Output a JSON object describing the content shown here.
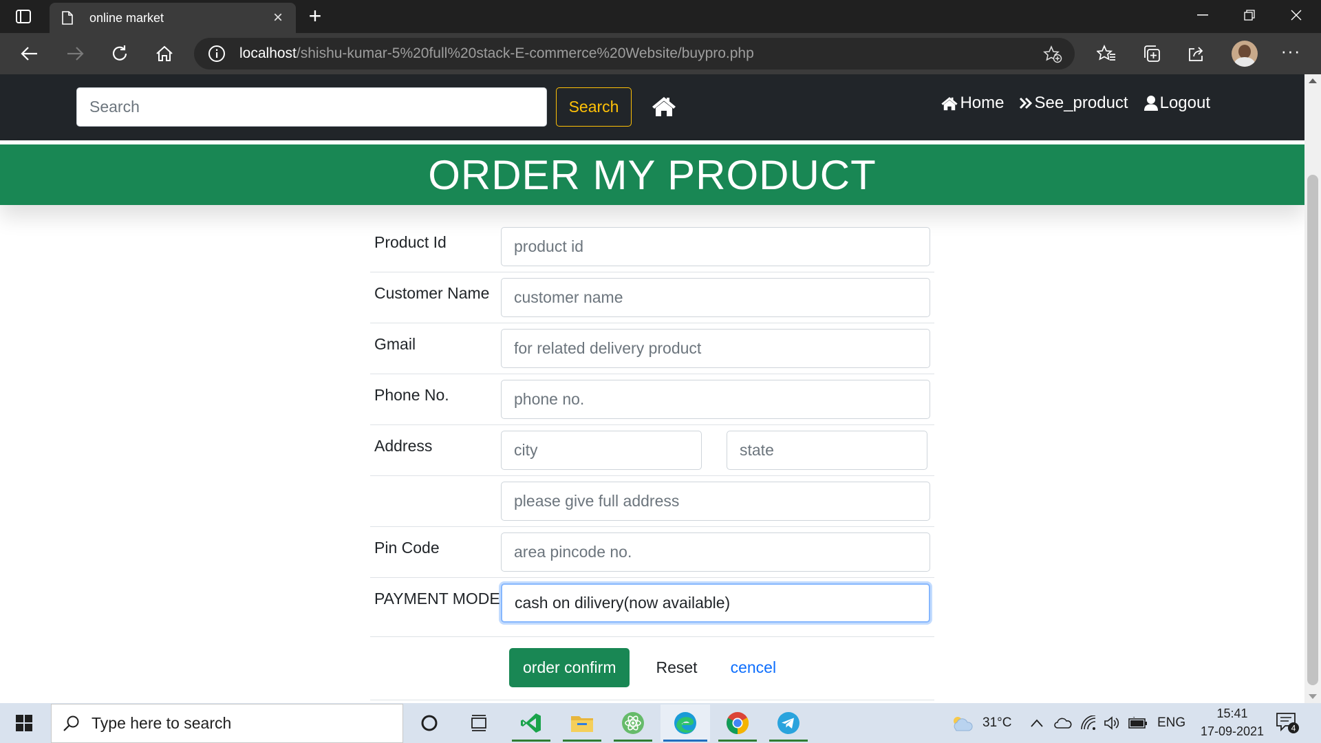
{
  "browser": {
    "tab_title": "online market",
    "url_host": "localhost",
    "url_path": "/shishu-kumar-5%20full%20stack-E-commerce%20Website/buypro.php"
  },
  "navbar": {
    "search_placeholder": "Search",
    "search_button": "Search",
    "links": [
      "Home",
      "See_product",
      "Logout"
    ]
  },
  "banner": {
    "title": "ORDER MY PRODUCT"
  },
  "form": {
    "rows": [
      {
        "label": "Product Id",
        "placeholder": "product id"
      },
      {
        "label": "Customer Name",
        "placeholder": "customer name"
      },
      {
        "label": "Gmail",
        "placeholder": "for related delivery product"
      },
      {
        "label": "Phone No.",
        "placeholder": "phone no."
      }
    ],
    "address": {
      "label": "Address",
      "city_placeholder": "city",
      "state_placeholder": "state",
      "full_placeholder": "please give full address"
    },
    "pincode": {
      "label": "Pin Code",
      "placeholder": "area pincode no."
    },
    "payment": {
      "label": "PAYMENT MODE",
      "value": "cash on dilivery(now available)"
    },
    "buttons": {
      "confirm": "order confirm",
      "reset": "Reset",
      "cancel": "cencel"
    }
  },
  "taskbar": {
    "search_placeholder": "Type here to search",
    "temperature": "31°C",
    "language": "ENG",
    "time": "15:41",
    "date": "17-09-2021",
    "notification_count": "4"
  },
  "colors": {
    "navbar_bg": "#212529",
    "banner_green": "#198754",
    "search_button_yellow": "#ffc107",
    "link_blue": "#0d6efd",
    "focus_border": "#86b7fe"
  },
  "icons": {
    "tab_actions": "tab-actions-icon",
    "page": "page-icon",
    "back": "back-arrow-icon",
    "forward": "forward-arrow-icon",
    "refresh": "refresh-icon",
    "home": "home-icon",
    "site_info": "info-icon",
    "add_favorite": "add-favorite-icon",
    "favorites": "favorites-icon",
    "collections": "collections-icon",
    "share": "share-icon",
    "site_home": "site-home-icon",
    "see_product": "double-chevron-icon",
    "logout": "user-icon",
    "windows": "windows-start-icon",
    "taskbar_search": "search-icon",
    "cortana": "cortana-icon",
    "task_view": "task-view-icon",
    "vscode": "vscode-icon",
    "file_explorer": "folder-icon",
    "atom": "atom-icon",
    "edge": "edge-icon",
    "chrome": "chrome-icon",
    "telegram": "telegram-icon",
    "weather": "cloud-sun-icon",
    "notifications": "notification-icon"
  }
}
